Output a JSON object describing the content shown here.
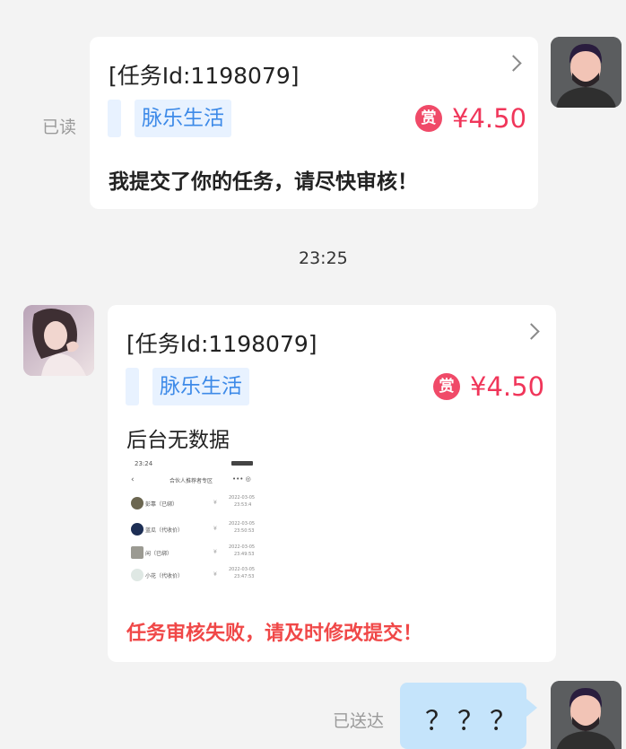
{
  "messages": {
    "first": {
      "status": "已读",
      "task_id": "[任务Id:1198079]",
      "tag": "脉乐生活",
      "reward_icon": "赏",
      "price": "¥4.50",
      "text": "我提交了你的任务，请尽快审核！"
    },
    "time_divider": "23:25",
    "second": {
      "task_id": "[任务Id:1198079]",
      "tag": "脉乐生活",
      "reward_icon": "赏",
      "price": "¥4.50",
      "text": "后台无数据",
      "screenshot": {
        "status_time": "23:24",
        "title": "合伙人推荐者专区",
        "rows": [
          {
            "name": "彭靠（已绑）",
            "yen": "¥",
            "date": "2022-03-05",
            "time": "23:53:4"
          },
          {
            "name": "蓝瓜（代收价）",
            "yen": "¥",
            "date": "2022-03-05",
            "time": "23:50:53"
          },
          {
            "name": "闲（已绑）",
            "yen": "¥",
            "date": "2022-03-05",
            "time": "23:49:53"
          },
          {
            "name": "小花（代收价）",
            "yen": "¥",
            "date": "2022-03-05",
            "time": "23:47:53"
          }
        ]
      },
      "warning": "任务审核失败，请及时修改提交！"
    },
    "third": {
      "status": "已送达",
      "text": "？？？"
    }
  },
  "colors": {
    "accent_red": "#f0365a",
    "tag_blue": "#3d8ae8",
    "bubble_blue": "#c5e4fb",
    "warning_red": "#f04848"
  }
}
